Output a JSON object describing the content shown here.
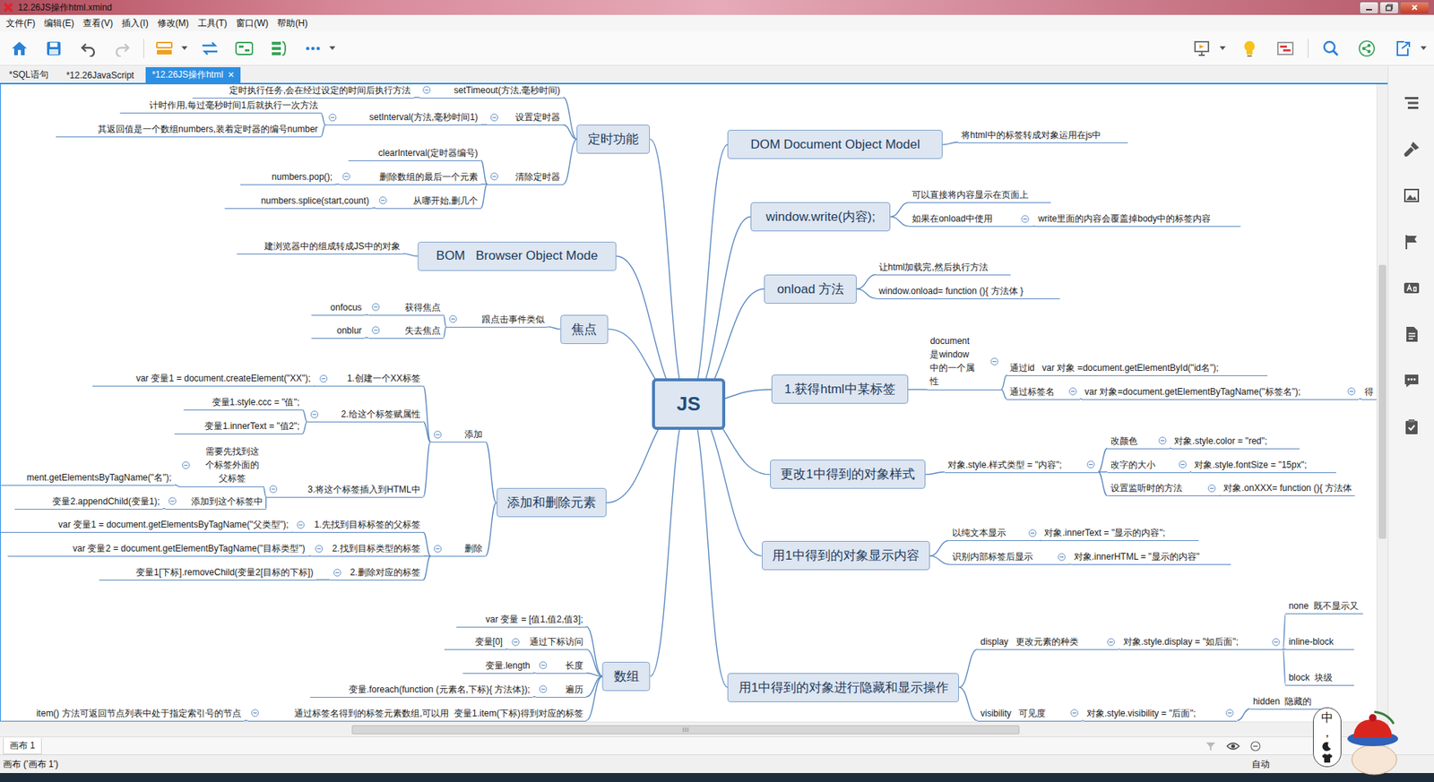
{
  "window": {
    "title": "12.26JS操作html.xmind"
  },
  "menu": [
    "文件(F)",
    "编辑(E)",
    "查看(V)",
    "插入(I)",
    "修改(M)",
    "工具(T)",
    "窗口(W)",
    "帮助(H)"
  ],
  "toolbar": {
    "undo": {
      "disabled": false
    },
    "redo": {
      "disabled": true
    }
  },
  "tabs": [
    {
      "label": "*SQL语句",
      "selected": false
    },
    {
      "label": "*12.26JavaScript",
      "selected": false
    },
    {
      "label": "*12.26JS操作html",
      "selected": true,
      "close": "✕"
    }
  ],
  "mindmap": {
    "center": "JS",
    "branches": [
      {
        "text": "DOM Document Object Model",
        "children": [
          {
            "text": "将html中的标签转成对象运用在js中"
          }
        ]
      },
      {
        "text": "window.write(内容);",
        "children": [
          {
            "text": "可以直接将内容显示在页面上"
          },
          {
            "text": "如果在onload中使用",
            "children": [
              {
                "text": "write里面的内容会覆盖掉body中的标签内容"
              }
            ]
          }
        ]
      },
      {
        "text": "onload 方法",
        "children": [
          {
            "text": "让html加载完,然后执行方法"
          },
          {
            "text": "window.onload= function (){ 方法体 }"
          }
        ]
      },
      {
        "text": "1.获得html中某标签",
        "children": [
          {
            "text": "document是window中的一个属性",
            "children": [
              {
                "text": "通过id   var 对象 =document.getElementById(\"id名\");"
              },
              {
                "text": "通过标签名",
                "children": [
                  {
                    "text": "var 对象=document.getElementByTagName(\"标签名\");",
                    "children": [
                      {
                        "text": "得"
                      }
                    ]
                  }
                ]
              }
            ]
          }
        ]
      },
      {
        "text": "更改1中得到的对象样式",
        "children": [
          {
            "text": "对象.style.样式类型 = \"内容\";",
            "children": [
              {
                "text": "改颜色",
                "children": [
                  {
                    "text": "对象.style.color = \"red\";"
                  }
                ]
              },
              {
                "text": "改字的大小",
                "children": [
                  {
                    "text": "对象.style.fontSize = \"15px\";"
                  }
                ]
              },
              {
                "text": "设置监听时的方法",
                "children": [
                  {
                    "text": "对象.onXXX= function (){ 方法体"
                  }
                ]
              }
            ]
          }
        ]
      },
      {
        "text": "用1中得到的对象显示内容",
        "children": [
          {
            "text": "以纯文本显示",
            "children": [
              {
                "text": "对象.innerText = \"显示的内容\";"
              }
            ]
          },
          {
            "text": "识别内部标签后显示",
            "children": [
              {
                "text": "对象.innerHTML = \"显示的内容\""
              }
            ]
          }
        ]
      },
      {
        "text": "用1中得到的对象进行隐藏和显示操作",
        "children": [
          {
            "text": "display   更改元素的种类",
            "children": [
              {
                "text": "对象.style.display = \"如后面\";",
                "children": [
                  {
                    "text": "none  既不显示又"
                  },
                  {
                    "text": "inline-block"
                  },
                  {
                    "text": "block  块级"
                  }
                ]
              }
            ]
          },
          {
            "text": "visibility   可见度",
            "children": [
              {
                "text": "对象.style.visibility = \"后面\";",
                "children": [
                  {
                    "text": "hidden  隐藏的"
                  }
                ]
              }
            ]
          }
        ]
      },
      {
        "text": "定时功能",
        "children": [
          {
            "text": "setTimeout(方法,毫秒时间)",
            "children": [
              {
                "text": "定时执行任务,会在经过设定的时间后执行方法"
              }
            ]
          },
          {
            "text": "设置定时器",
            "children": [
              {
                "text": "setInterval(方法,毫秒时间1)",
                "children": [
                  {
                    "text": "计时作用,每过毫秒时间1后就执行一次方法"
                  },
                  {
                    "text": "其返回值是一个数组numbers,装着定时器的编号number"
                  }
                ]
              }
            ]
          },
          {
            "text": "清除定时器",
            "children": [
              {
                "text": "clearInterval(定时器编号)"
              },
              {
                "text": "删除数组的最后一个元素",
                "children": [
                  {
                    "text": "numbers.pop();"
                  }
                ]
              },
              {
                "text": "从哪开始,删几个",
                "children": [
                  {
                    "text": "numbers.splice(start,count)"
                  }
                ]
              }
            ]
          }
        ]
      },
      {
        "text": "BOM   Browser Object Mode",
        "children": [
          {
            "text": "建浏览器中的组成转成JS中的对象"
          }
        ]
      },
      {
        "text": "焦点",
        "children": [
          {
            "text": "跟点击事件类似",
            "children": [
              {
                "text": "获得焦点",
                "children": [
                  {
                    "text": "onfocus"
                  }
                ]
              },
              {
                "text": "失去焦点",
                "children": [
                  {
                    "text": "onblur"
                  }
                ]
              }
            ]
          }
        ]
      },
      {
        "text": "添加和删除元素",
        "children": [
          {
            "text": "添加",
            "children": [
              {
                "text": "1.创建一个XX标签",
                "children": [
                  {
                    "text": "var 变量1 = document.createElement(\"XX\");"
                  }
                ]
              },
              {
                "text": "2.给这个标签赋属性",
                "children": [
                  {
                    "text": "变量1.style.ccc = \"值\";"
                  },
                  {
                    "text": "变量1.innerText = \"值2\";"
                  }
                ]
              },
              {
                "text": "3.将这个标签插入到HTML中",
                "children": [
                  {
                    "text": "需要先找到这个标签外面的父标签",
                    "children": [
                      {
                        "text": "ment.getElementsByTagName(\"名\");"
                      }
                    ]
                  },
                  {
                    "text": "添加到这个标签中",
                    "children": [
                      {
                        "text": "变量2.appendChild(变量1);"
                      }
                    ]
                  }
                ]
              }
            ]
          },
          {
            "text": "删除",
            "children": [
              {
                "text": "1.先找到目标标签的父标签",
                "children": [
                  {
                    "text": "var 变量1 = document.getElementsByTagName(\"父类型\");"
                  }
                ]
              },
              {
                "text": "2.找到目标类型的标签",
                "children": [
                  {
                    "text": "var 变量2 = document.getElementByTagName(\"目标类型\")"
                  }
                ]
              },
              {
                "text": "2.删除对应的标签",
                "children": [
                  {
                    "text": "变量1[下标].removeChild(变量2[目标的下标])"
                  }
                ]
              }
            ]
          }
        ]
      },
      {
        "text": "数组",
        "children": [
          {
            "text": "var 变量 = [值1,值2,值3];"
          },
          {
            "text": "通过下标访问",
            "children": [
              {
                "text": "变量[0]"
              }
            ]
          },
          {
            "text": "长度",
            "children": [
              {
                "text": "变量.length"
              }
            ]
          },
          {
            "text": "遍历",
            "children": [
              {
                "text": "变量.foreach(function (元素名,下标){ 方法体});"
              }
            ]
          },
          {
            "text": "通过标签名得到的标签元素数组,可以用  变量1.item(下标)得到对应的标签",
            "children": [
              {
                "text": "item() 方法可返回节点列表中处于指定索引号的节点"
              }
            ]
          }
        ]
      }
    ]
  },
  "sheet_tabs": [
    {
      "label": "画布 1",
      "selected": true
    }
  ],
  "status_bar": {
    "left": "画布 ('画布 1')",
    "right": "自动"
  },
  "ime": [
    "中",
    "，"
  ]
}
